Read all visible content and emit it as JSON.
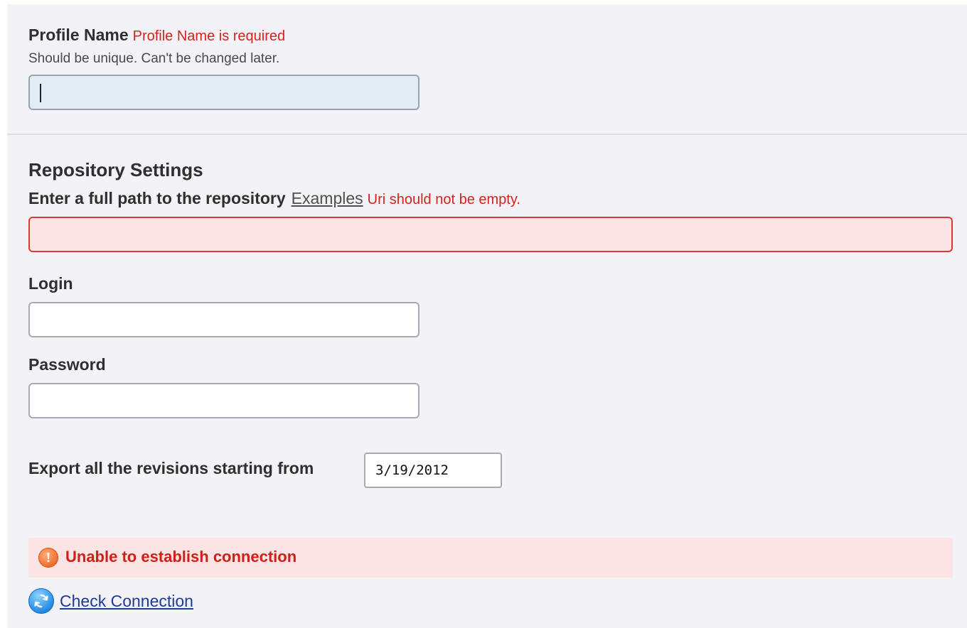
{
  "profile": {
    "label": "Profile Name",
    "error": "Profile Name is required",
    "hint": "Should be unique. Can't be changed later.",
    "value": ""
  },
  "repository": {
    "title": "Repository Settings",
    "path_label": "Enter a full path to the repository",
    "examples_link": "Examples",
    "path_error": "Uri should not be empty.",
    "path_value": ""
  },
  "login": {
    "label": "Login",
    "value": ""
  },
  "password": {
    "label": "Password",
    "value": ""
  },
  "export": {
    "label": "Export all the revisions starting from",
    "date_value": "3/19/2012"
  },
  "alert": {
    "icon": "exclamation-icon",
    "glyph": "!",
    "message": "Unable to establish connection",
    "color": "#cf1f16",
    "background": "#fce3e4"
  },
  "check_connection": {
    "icon": "refresh-icon",
    "label": "Check Connection"
  }
}
